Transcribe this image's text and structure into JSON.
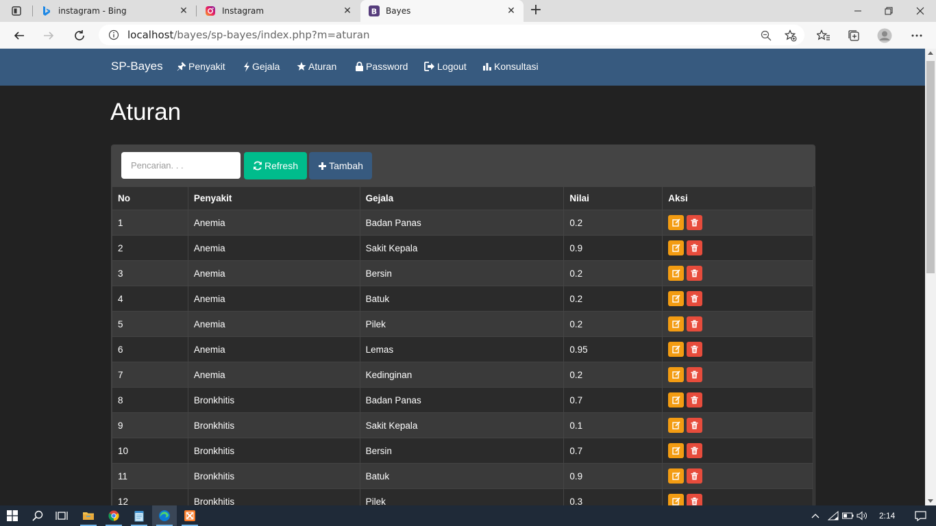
{
  "browser": {
    "tabs": [
      {
        "title": "instagram - Bing",
        "icon": "bing-icon",
        "active": false
      },
      {
        "title": "Instagram",
        "icon": "instagram-icon",
        "active": false
      },
      {
        "title": "Bayes",
        "icon": "bootstrap-icon",
        "active": true
      }
    ],
    "url": {
      "host": "localhost",
      "path": "/bayes/sp-bayes/index.php?m=aturan"
    }
  },
  "navbar": {
    "brand": "SP-Bayes",
    "items": [
      {
        "label": "Penyakit",
        "icon": "pushpin-icon"
      },
      {
        "label": "Gejala",
        "icon": "flash-icon"
      },
      {
        "label": "Aturan",
        "icon": "star-icon"
      },
      {
        "label": "Password",
        "icon": "lock-icon"
      },
      {
        "label": "Logout",
        "icon": "logout-icon"
      },
      {
        "label": "Konsultasi",
        "icon": "stats-icon"
      }
    ]
  },
  "page": {
    "title": "Aturan",
    "search_placeholder": "Pencarian. . .",
    "refresh_label": "Refresh",
    "add_label": "Tambah"
  },
  "table": {
    "headers": [
      "No",
      "Penyakit",
      "Gejala",
      "Nilai",
      "Aksi"
    ],
    "rows": [
      [
        "1",
        "Anemia",
        "Badan Panas",
        "0.2"
      ],
      [
        "2",
        "Anemia",
        "Sakit Kepala",
        "0.9"
      ],
      [
        "3",
        "Anemia",
        "Bersin",
        "0.2"
      ],
      [
        "4",
        "Anemia",
        "Batuk",
        "0.2"
      ],
      [
        "5",
        "Anemia",
        "Pilek",
        "0.2"
      ],
      [
        "6",
        "Anemia",
        "Lemas",
        "0.95"
      ],
      [
        "7",
        "Anemia",
        "Kedinginan",
        "0.2"
      ],
      [
        "8",
        "Bronkhitis",
        "Badan Panas",
        "0.7"
      ],
      [
        "9",
        "Bronkhitis",
        "Sakit Kepala",
        "0.1"
      ],
      [
        "10",
        "Bronkhitis",
        "Bersin",
        "0.7"
      ],
      [
        "11",
        "Bronkhitis",
        "Batuk",
        "0.9"
      ],
      [
        "12",
        "Bronkhitis",
        "Pilek",
        "0.3"
      ]
    ]
  },
  "taskbar": {
    "clock": "2:14",
    "apps": [
      "file-explorer-icon",
      "chrome-icon",
      "notepad-icon",
      "edge-icon",
      "xampp-icon"
    ]
  },
  "colors": {
    "navbar": "#375a7f",
    "body": "#222222",
    "refresh": "#00bc8c",
    "edit": "#f39c12",
    "delete": "#e74c3c"
  }
}
